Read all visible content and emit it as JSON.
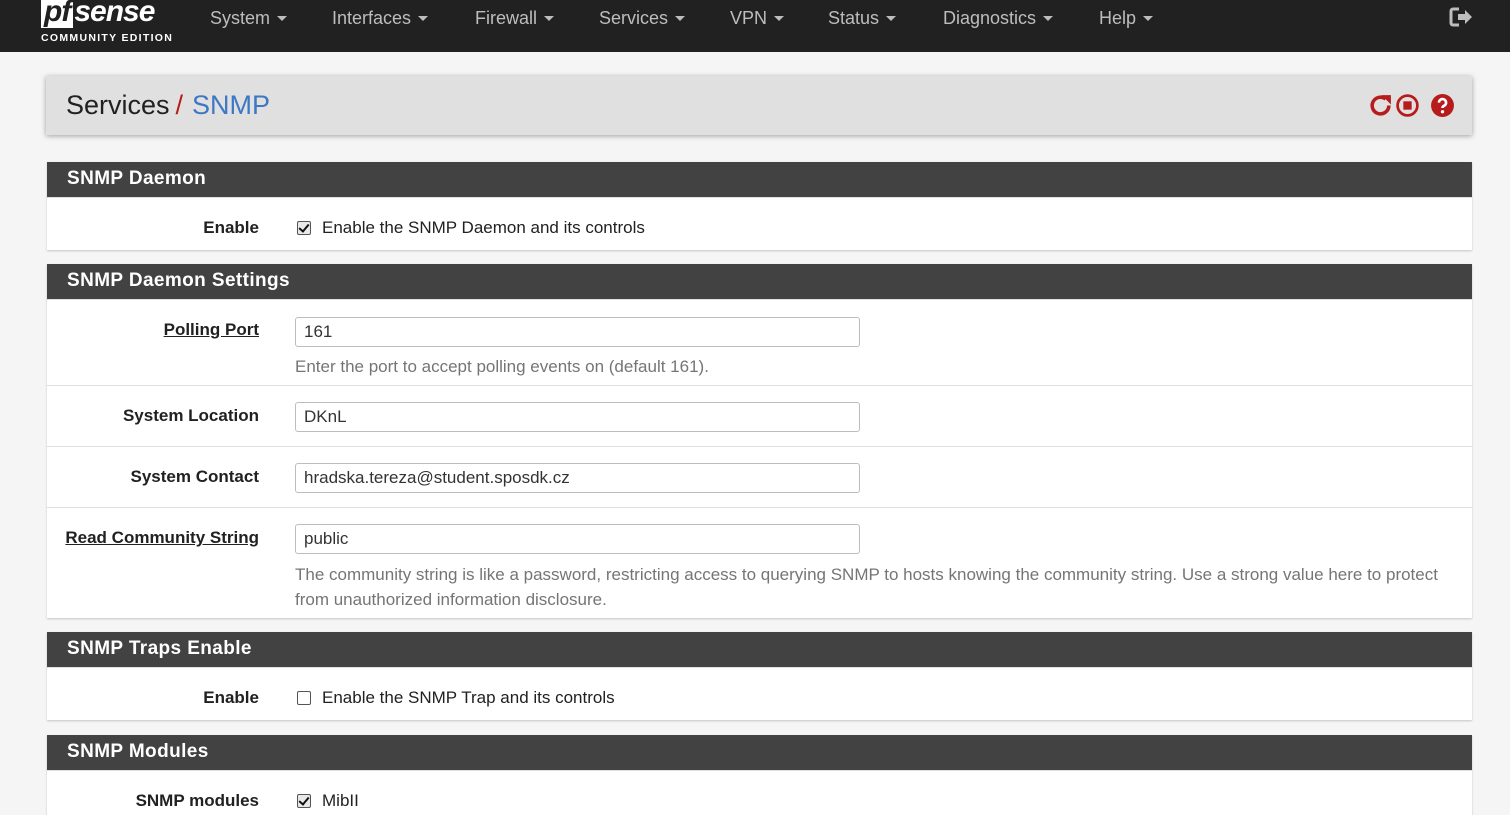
{
  "brand": {
    "logo_pf": "pf",
    "logo_sense": "sense",
    "edition": "COMMUNITY EDITION"
  },
  "nav": {
    "items": [
      {
        "label": "System"
      },
      {
        "label": "Interfaces"
      },
      {
        "label": "Firewall"
      },
      {
        "label": "Services"
      },
      {
        "label": "VPN"
      },
      {
        "label": "Status"
      },
      {
        "label": "Diagnostics"
      },
      {
        "label": "Help"
      }
    ],
    "logout_icon": "sign-out-icon"
  },
  "header": {
    "breadcrumb_parent": "Services",
    "breadcrumb_separator": "/",
    "breadcrumb_current": "SNMP",
    "icons": [
      "restart-icon",
      "stop-icon",
      "help-icon"
    ],
    "icon_color": "#b71c1c",
    "current_color": "#3c78c3"
  },
  "daemon": {
    "title": "SNMP Daemon",
    "enable_label": "Enable",
    "enable_text": "Enable the SNMP Daemon and its controls",
    "enable_checked": true
  },
  "settings": {
    "title": "SNMP Daemon Settings",
    "polling_port_label": "Polling Port",
    "polling_port_value": "161",
    "polling_port_help": "Enter the port to accept polling events on (default 161).",
    "location_label": "System Location",
    "location_value": "DKnL",
    "contact_label": "System Contact",
    "contact_value": "hradska.tereza@student.sposdk.cz",
    "community_label": "Read Community String",
    "community_value": "public",
    "community_help": "The community string is like a password, restricting access to querying SNMP to hosts knowing the community string. Use a strong value here to protect from unauthorized information disclosure."
  },
  "traps": {
    "title": "SNMP Traps Enable",
    "enable_label": "Enable",
    "enable_text": "Enable the SNMP Trap and its controls",
    "enable_checked": false
  },
  "modules": {
    "title": "SNMP Modules",
    "modules_label": "SNMP modules",
    "first_module": "MibII",
    "first_module_checked": true
  }
}
